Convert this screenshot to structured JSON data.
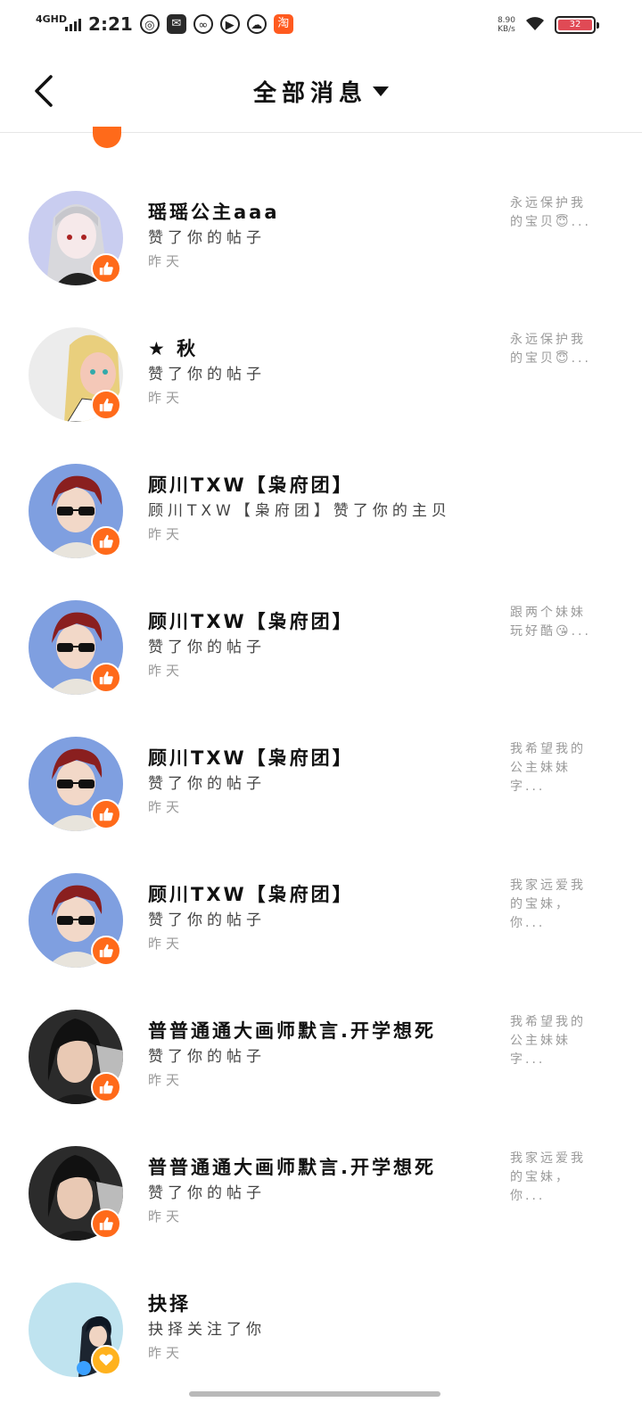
{
  "status_bar": {
    "network": "4GHD",
    "time": "2:21",
    "speed": "8.90\nKB/s",
    "battery": "32"
  },
  "header": {
    "title": "全部消息"
  },
  "items": [
    {
      "name": "瑶瑶公主aaa",
      "action": "赞了你的帖子",
      "time": "昨天",
      "quote": "永远保护我的宝贝😇..."
    },
    {
      "name": "★ 秋",
      "action": "赞了你的帖子",
      "time": "昨天",
      "quote": "永远保护我的宝贝😇..."
    },
    {
      "name": "顾川TXW【枭府团】",
      "action": "顾川TXW【枭府团】赞了你的主贝",
      "time": "昨天",
      "quote": ""
    },
    {
      "name": "顾川TXW【枭府团】",
      "action": "赞了你的帖子",
      "time": "昨天",
      "quote": "跟两个妹妹玩好酷😘..."
    },
    {
      "name": "顾川TXW【枭府团】",
      "action": "赞了你的帖子",
      "time": "昨天",
      "quote": "我希望我的公主妹妹字..."
    },
    {
      "name": "顾川TXW【枭府团】",
      "action": "赞了你的帖子",
      "time": "昨天",
      "quote": "我家远爱我的宝妹，你..."
    },
    {
      "name": "普普通通大画师默言.开学想死",
      "action": "赞了你的帖子",
      "time": "昨天",
      "quote": "我希望我的公主妹妹字..."
    },
    {
      "name": "普普通通大画师默言.开学想死",
      "action": "赞了你的帖子",
      "time": "昨天",
      "quote": "我家远爱我的宝妹，你..."
    },
    {
      "name": "抉择",
      "action": "抉择关注了你",
      "time": "昨天",
      "quote": ""
    }
  ]
}
